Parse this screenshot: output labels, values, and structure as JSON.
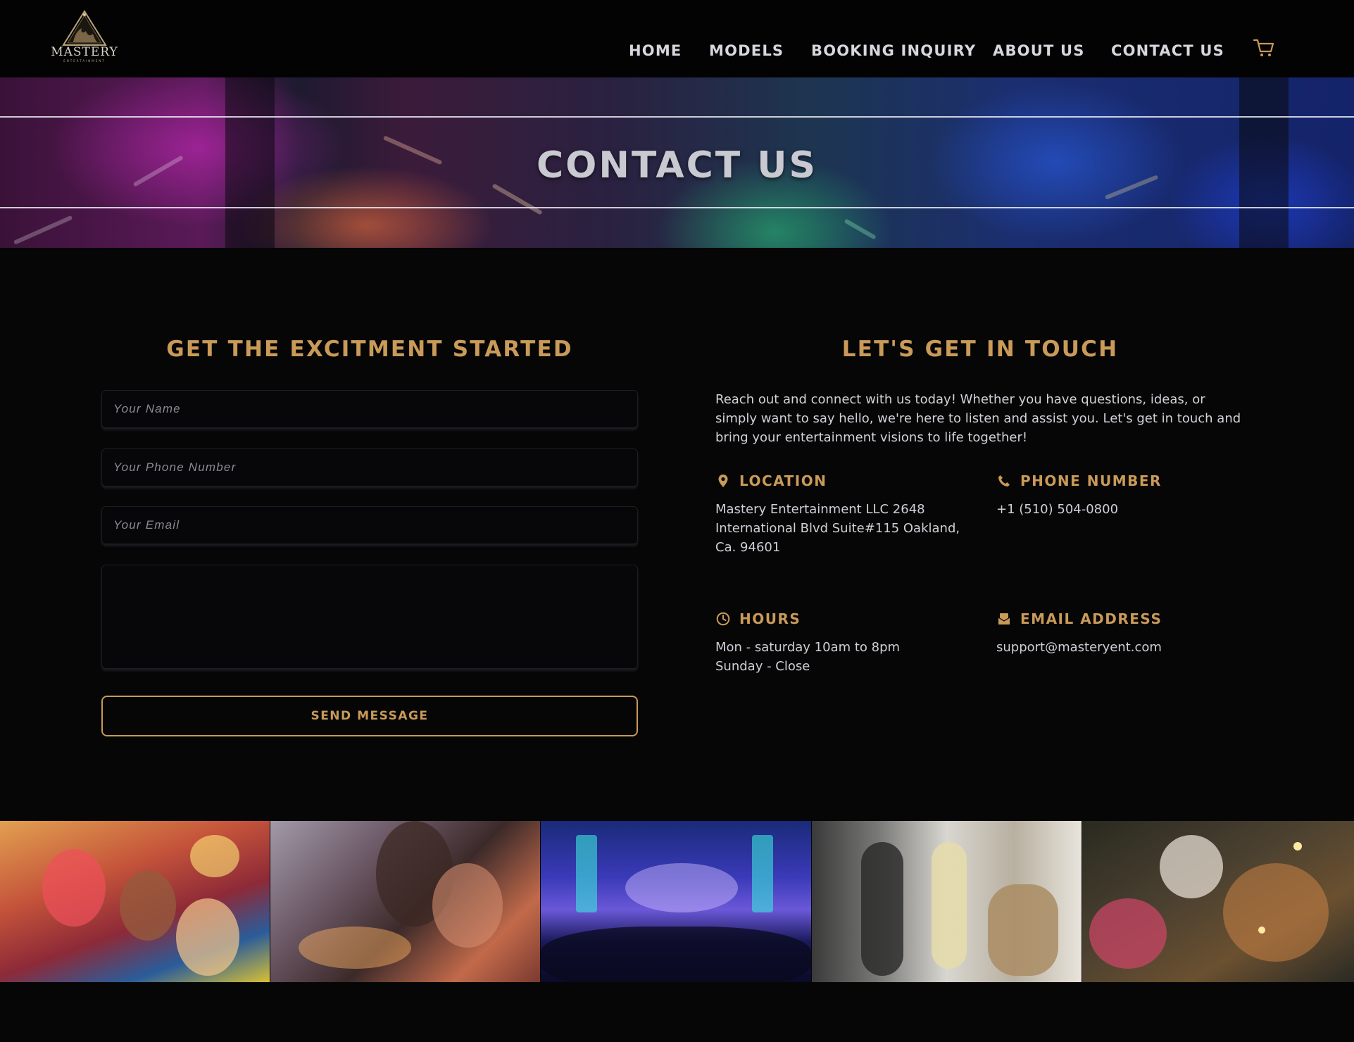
{
  "brand": {
    "name": "MASTERY",
    "tagline": "ENTERTAINMENT"
  },
  "nav": {
    "items": [
      {
        "label": "HOME"
      },
      {
        "label": "MODELS"
      },
      {
        "label": "BOOKING INQUIRY"
      },
      {
        "label": "ABOUT US"
      },
      {
        "label": "CONTACT US"
      }
    ],
    "cart_icon": "shopping-cart-icon"
  },
  "hero": {
    "title": "CONTACT US"
  },
  "form": {
    "heading": "GET THE EXCITMENT STARTED",
    "name_placeholder": "Your Name",
    "phone_placeholder": "Your Phone Number",
    "email_placeholder": "Your Email",
    "message_placeholder": "",
    "submit_label": "SEND MESSAGE"
  },
  "contact": {
    "heading": "LET'S GET IN TOUCH",
    "intro": "Reach out and connect with us today! Whether you have questions, ideas, or simply want to say hello, we're here to listen and assist you. Let's get in touch and bring your entertainment visions to life together!",
    "location": {
      "title": "LOCATION",
      "icon": "map-pin-icon",
      "text": "Mastery Entertainment LLC 2648\nInternational Blvd Suite#115 Oakland,\nCa. 94601"
    },
    "phone": {
      "title": "PHONE NUMBER",
      "icon": "phone-icon",
      "text": "+1 (510) 504-0800"
    },
    "hours": {
      "title": "HOURS",
      "icon": "clock-icon",
      "text": "Mon - saturday 10am to 8pm\nSunday - Close"
    },
    "email": {
      "title": "EMAIL ADDRESS",
      "icon": "envelope-icon",
      "text": "support@masteryent.com"
    }
  },
  "colors": {
    "accent": "#c99a58",
    "background": "#060607",
    "header": "#030304",
    "text": "#cfcfd6"
  }
}
